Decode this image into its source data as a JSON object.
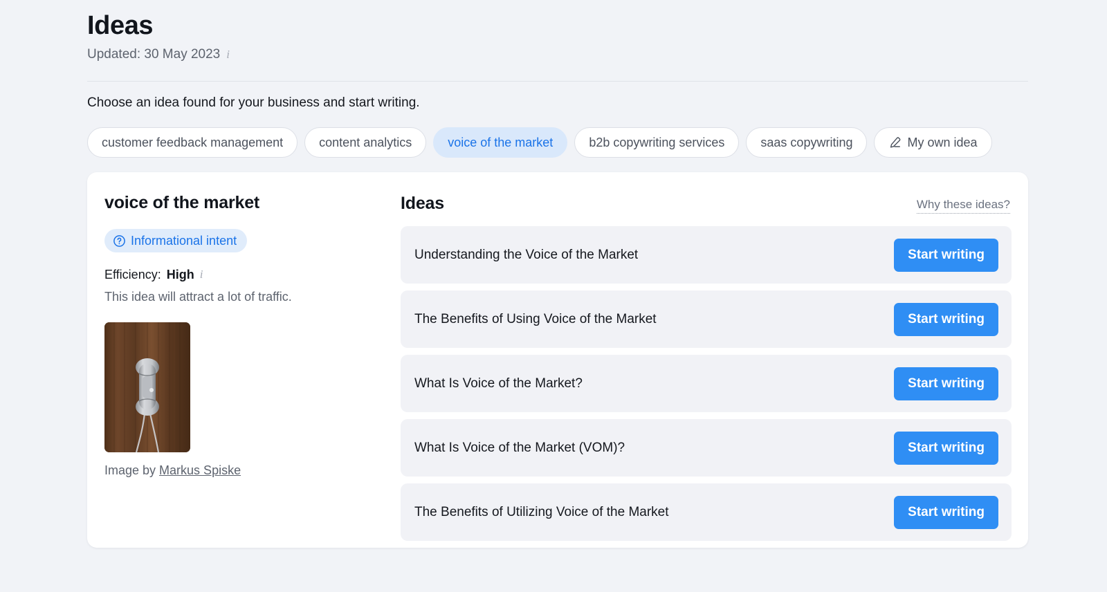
{
  "header": {
    "title": "Ideas",
    "updated_label": "Updated: 30 May 2023",
    "info_icon": "info-i-icon",
    "info_glyph": "i"
  },
  "subtitle": "Choose an idea found for your business and start writing.",
  "chips": [
    {
      "label": "customer feedback management",
      "selected": false,
      "icon": null
    },
    {
      "label": "content analytics",
      "selected": false,
      "icon": null
    },
    {
      "label": "voice of the market",
      "selected": true,
      "icon": null
    },
    {
      "label": "b2b copywriting services",
      "selected": false,
      "icon": null
    },
    {
      "label": "saas copywriting",
      "selected": false,
      "icon": null
    },
    {
      "label": "My own idea",
      "selected": false,
      "icon": "pencil-icon"
    }
  ],
  "detail": {
    "idea_name": "voice of the market",
    "intent_badge": "Informational intent",
    "intent_icon": "question-circle-icon",
    "efficiency_label": "Efficiency:",
    "efficiency_value": "High",
    "efficiency_info_glyph": "i",
    "efficiency_desc": "This idea will attract a lot of traffic.",
    "image_alt": "wall-mounted telephone on wood panel",
    "credit_prefix": "Image by ",
    "credit_author": "Markus Spiske"
  },
  "ideas_panel": {
    "heading": "Ideas",
    "why_link": "Why these ideas?",
    "button_label": "Start writing",
    "items": [
      {
        "title": "Understanding the Voice of the Market"
      },
      {
        "title": "The Benefits of Using Voice of the Market"
      },
      {
        "title": "What Is Voice of the Market?"
      },
      {
        "title": "What Is Voice of the Market (VOM)?"
      },
      {
        "title": "The Benefits of Utilizing Voice of the Market"
      }
    ]
  },
  "colors": {
    "page_bg": "#f1f3f7",
    "card_bg": "#ffffff",
    "accent_blue": "#2f8ef4",
    "chip_selected_bg": "#d9e8fb",
    "chip_selected_text": "#1a73e8",
    "row_bg": "#f1f2f6",
    "badge_bg": "#e0ecfb"
  }
}
